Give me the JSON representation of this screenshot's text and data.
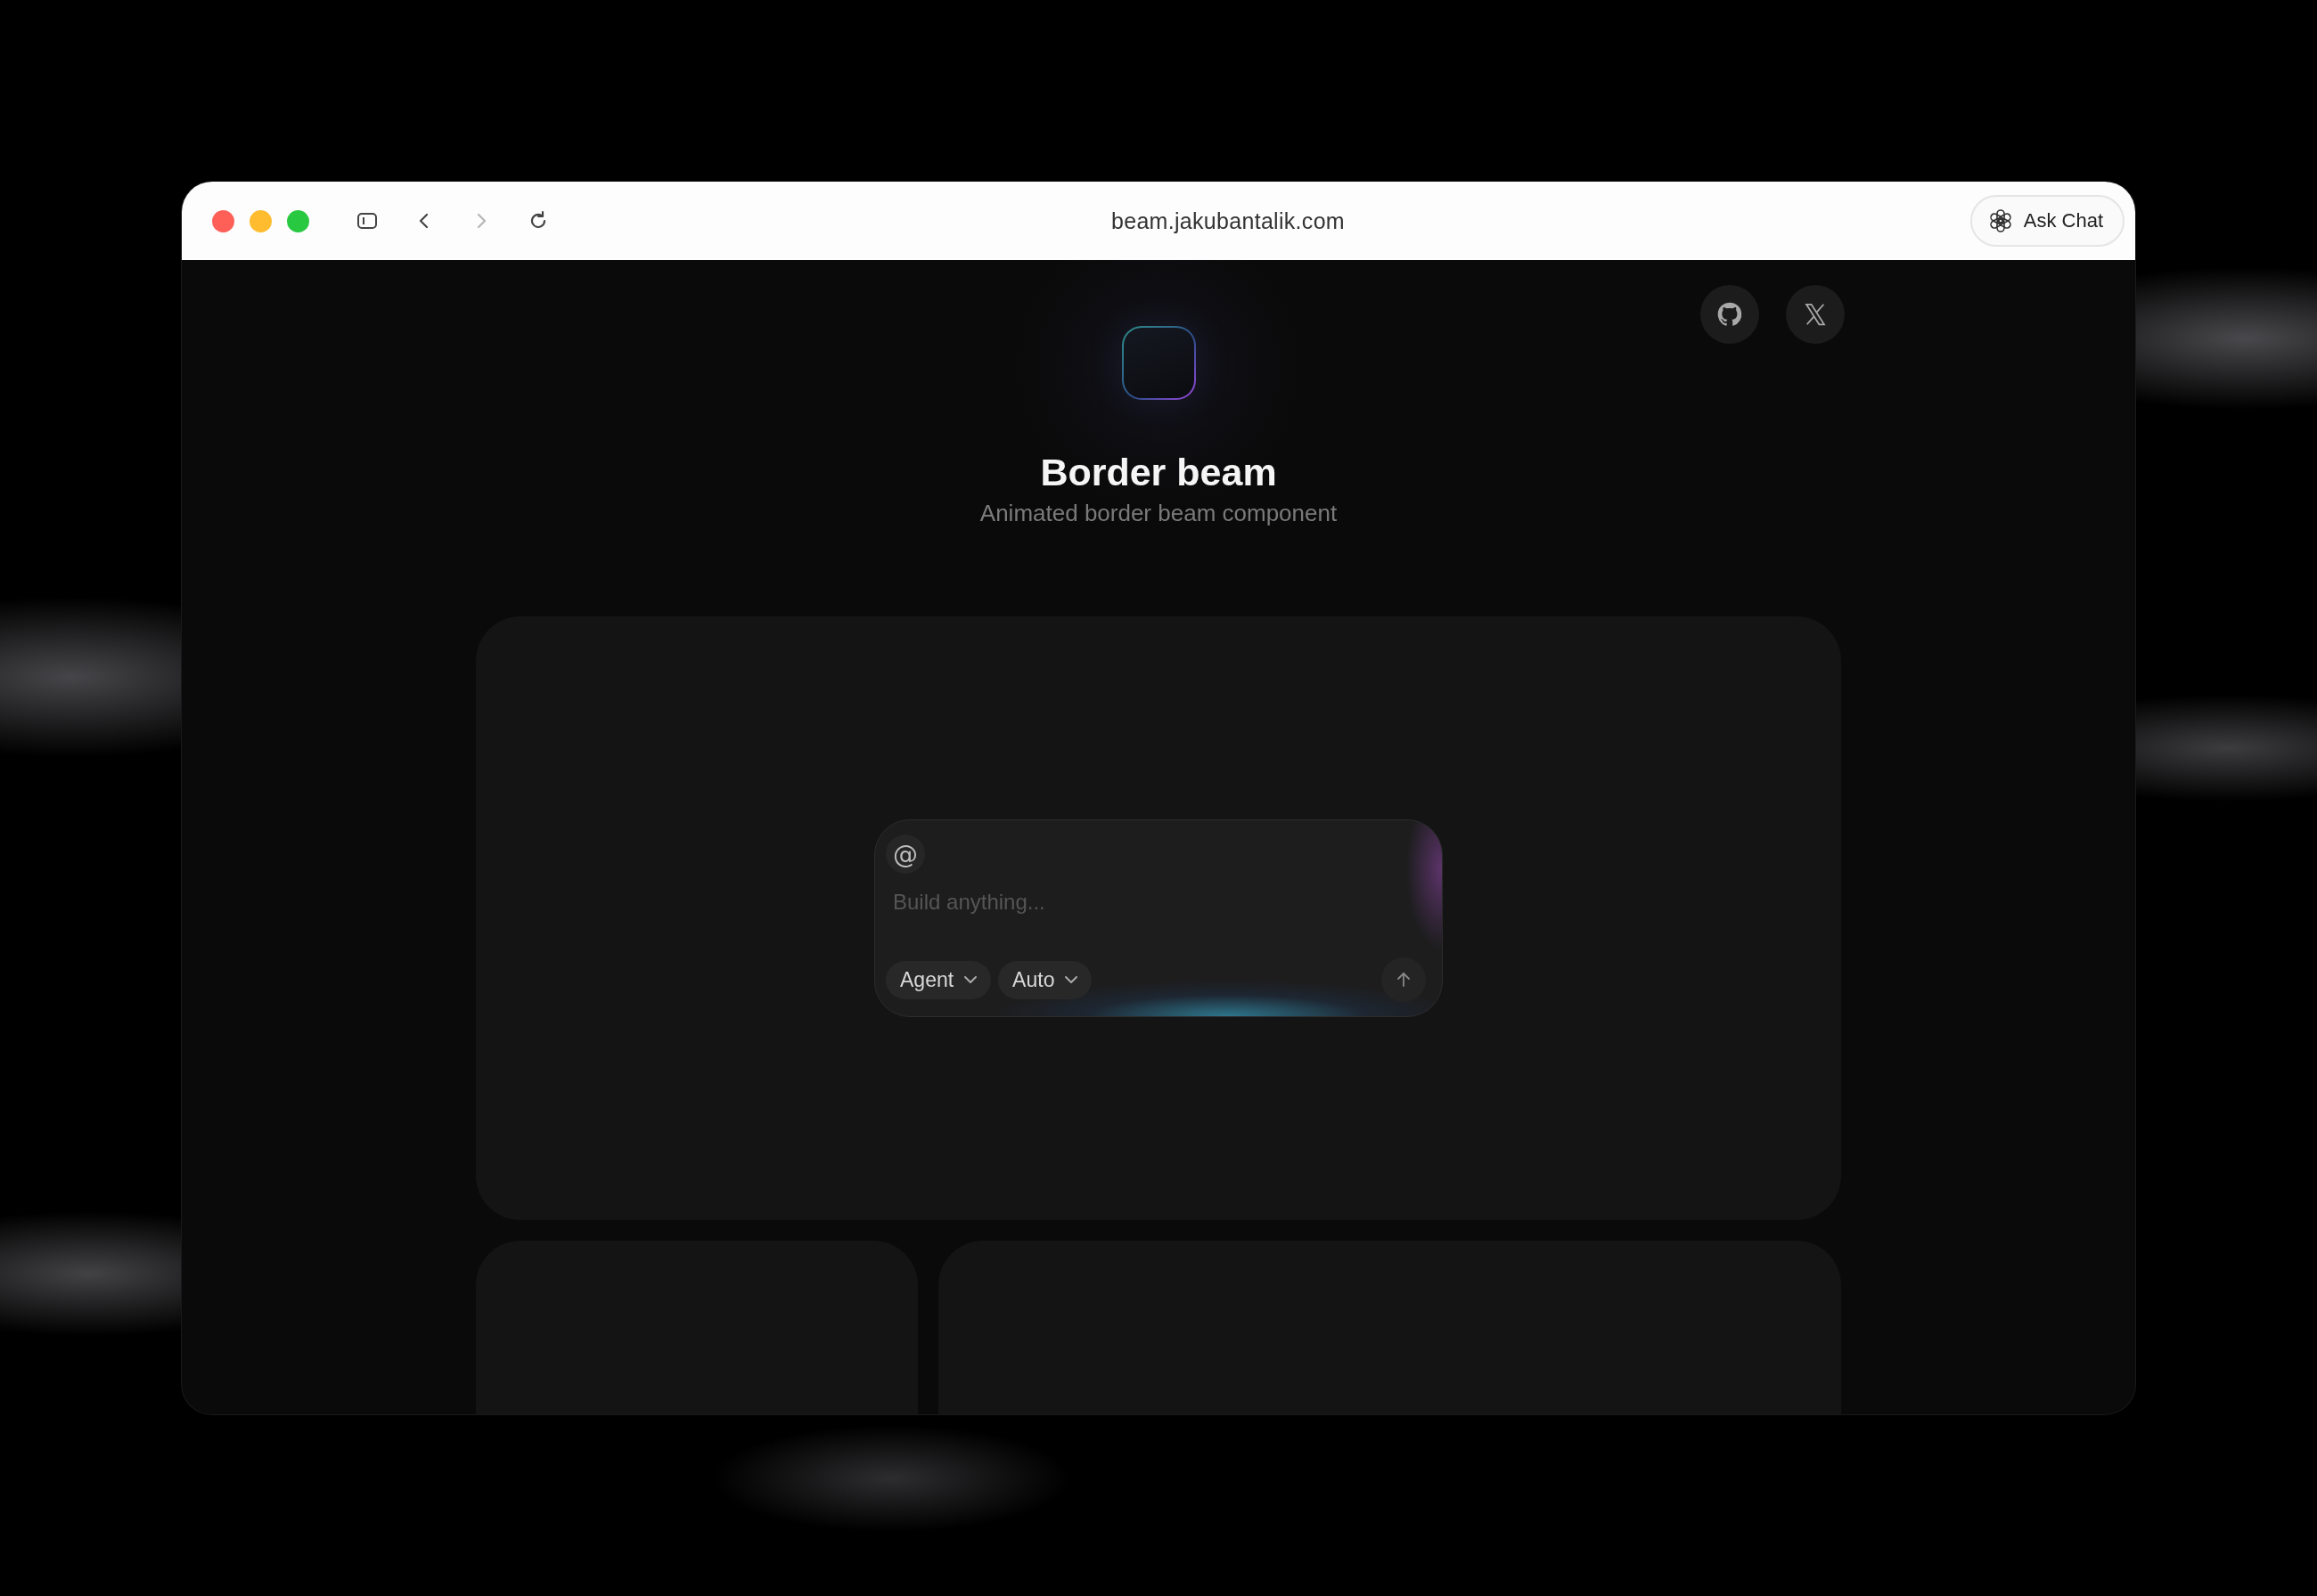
{
  "browser": {
    "url": "beam.jakubantalik.com",
    "ask_chat_label": "Ask Chat",
    "nav_buttons": [
      {
        "kind": "sidebar",
        "disabled": false
      },
      {
        "kind": "back",
        "disabled": false
      },
      {
        "kind": "forward",
        "disabled": true
      },
      {
        "kind": "reload",
        "disabled": false
      }
    ]
  },
  "page": {
    "social_links": [
      {
        "kind": "github"
      },
      {
        "kind": "x"
      }
    ],
    "title": "Border beam",
    "subtitle": "Animated border beam component",
    "prompt": {
      "mention_symbol": "@",
      "placeholder": "Build anything...",
      "selectors": [
        {
          "label": "Agent"
        },
        {
          "label": "Auto"
        }
      ]
    }
  }
}
